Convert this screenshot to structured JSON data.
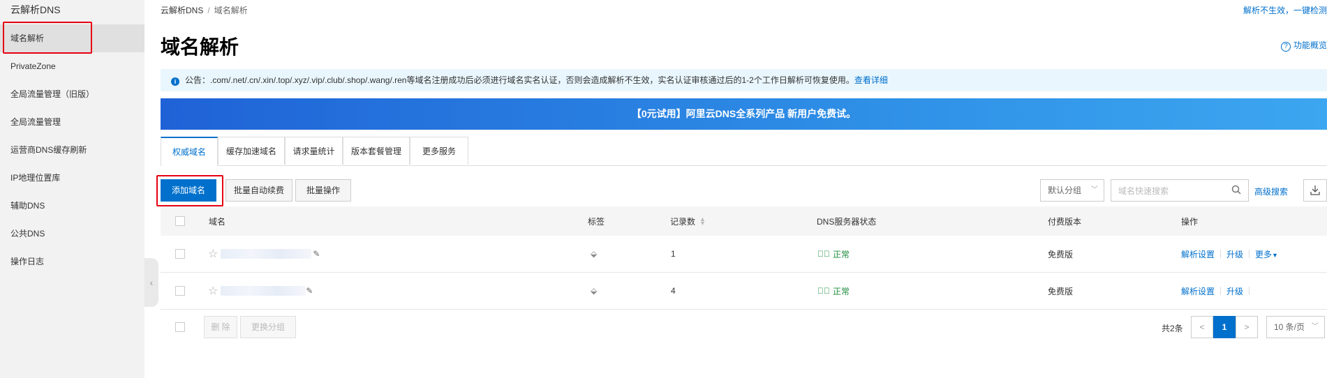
{
  "sidebar": {
    "title": "云解析DNS",
    "items": [
      {
        "label": "域名解析"
      },
      {
        "label": "PrivateZone"
      },
      {
        "label": "全局流量管理（旧版）"
      },
      {
        "label": "全局流量管理"
      },
      {
        "label": "运营商DNS缓存刷新"
      },
      {
        "label": "IP地理位置库"
      },
      {
        "label": "辅助DNS"
      },
      {
        "label": "公共DNS"
      },
      {
        "label": "操作日志"
      }
    ],
    "collapse_icon": "chevron-left-icon"
  },
  "breadcrumb": {
    "root": "云解析DNS",
    "separator": "/",
    "current": "域名解析"
  },
  "top_link": "解析不生效，一键检测",
  "page_title": "域名解析",
  "func_overview": {
    "icon": "?",
    "label": "功能概览"
  },
  "notice": {
    "icon": "i",
    "text": "公告：.com/.net/.cn/.xin/.top/.xyz/.vip/.club/.shop/.wang/.ren等域名注册成功后必须进行域名实名认证，否则会造成解析不生效，实名认证审核通过后的1-2个工作日解析可恢复使用。",
    "link": "查看详细"
  },
  "banner": "【0元试用】阿里云DNS全系列产品 新用户免费试。",
  "tabs": [
    {
      "label": "权威域名",
      "active": true
    },
    {
      "label": "缓存加速域名"
    },
    {
      "label": "请求量统计"
    },
    {
      "label": "版本套餐管理"
    },
    {
      "label": "更多服务"
    }
  ],
  "toolbar": {
    "add_domain": "添加域名",
    "batch_renew": "批量自动续费",
    "batch_ops": "批量操作",
    "group_select": "默认分组",
    "search_placeholder": "域名快速搜索",
    "advanced_search": "高级搜索"
  },
  "table": {
    "headers": {
      "domain": "域名",
      "tag": "标签",
      "records": "记录数",
      "dns_status": "DNS服务器状态",
      "version": "付费版本",
      "actions": "操作"
    },
    "rows": [
      {
        "records": "1",
        "status": "正常",
        "version": "免费版",
        "a1": "解析设置",
        "a2": "升级",
        "a3": "更多"
      },
      {
        "records": "4",
        "status": "正常",
        "version": "免费版",
        "a1": "解析设置",
        "a2": "升级",
        "a3": ""
      }
    ]
  },
  "footer": {
    "delete": "删 除",
    "change_group": "更换分组",
    "total": "共2条",
    "prev": "<",
    "page": "1",
    "next": ">",
    "page_size": "10 条/页"
  },
  "colors": {
    "accent": "#0070cc",
    "highlight": "#e60012",
    "ok": "#1e8e3e"
  }
}
